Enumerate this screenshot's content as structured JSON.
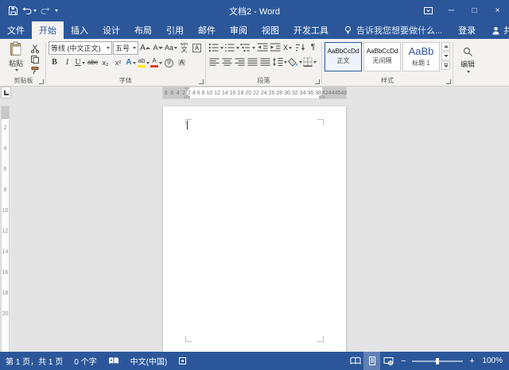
{
  "titlebar": {
    "title": "文档2 - Word",
    "window_controls": {
      "minimize": "─",
      "maximize": "□",
      "close": "×"
    }
  },
  "tabbar": {
    "file_tab": "文件",
    "tabs": [
      "开始",
      "插入",
      "设计",
      "布局",
      "引用",
      "邮件",
      "审阅",
      "视图",
      "开发工具"
    ],
    "tell_me": "告诉我您想要做什么...",
    "sign_in": "登录",
    "share": "共享"
  },
  "ribbon": {
    "clipboard": {
      "label": "剪贴板",
      "paste": "粘贴"
    },
    "font": {
      "label": "字体",
      "name": "等线 (中文正文)",
      "size": "五号",
      "grow": "A",
      "shrink": "A",
      "change_case": "Aa",
      "phonetic_ruby": "wén",
      "phonetic_base": "文",
      "char_border": "A",
      "bold": "B",
      "italic": "I",
      "underline": "U",
      "strikethrough": "abc",
      "subscript": "x₂",
      "superscript": "x²",
      "text_effects": "A",
      "highlight": "ab",
      "font_color": "A",
      "enclose": "字",
      "char_shading": "A"
    },
    "paragraph": {
      "label": "段落",
      "asian_layout": "X",
      "pilcrow": "¶"
    },
    "styles": {
      "label": "样式",
      "items": [
        {
          "preview": "AaBbCcDd",
          "name": "正文"
        },
        {
          "preview": "AaBbCcDd",
          "name": "无间隔"
        },
        {
          "preview": "AaBb",
          "name": "标题 1"
        }
      ]
    },
    "editing": {
      "label": "编辑"
    }
  },
  "ruler": {
    "left_margin": [
      "8",
      "6",
      "4",
      "2"
    ],
    "text_area": [
      "2",
      "4",
      "6",
      "8",
      "10",
      "12",
      "14",
      "16",
      "18",
      "20",
      "22",
      "24",
      "26",
      "28",
      "30",
      "32",
      "34",
      "36",
      "38"
    ],
    "right_margin": [
      "42",
      "44",
      "46",
      "48"
    ],
    "vertical": [
      "2",
      "4",
      "6",
      "8",
      "10",
      "12",
      "14",
      "16",
      "18",
      "20"
    ]
  },
  "statusbar": {
    "page_info": "第 1 页，共 1 页",
    "word_count": "0 个字",
    "language": "中文(中国)",
    "zoom_out": "−",
    "zoom_in": "+",
    "zoom_level": "100%"
  },
  "colors": {
    "accent": "#2b579a",
    "ribbon_background": "#f3f2f1",
    "document_background": "#e4e4e4",
    "page_background": "#ffffff",
    "heading_style_blue": "#2f5496",
    "highlight_yellow": "#ffe400",
    "font_color_red": "#e03e2d"
  },
  "icons": {
    "quick_access": [
      "save-icon",
      "undo-icon",
      "redo-icon"
    ],
    "clipboard": [
      "paste-clipboard-icon",
      "cut-scissors-icon",
      "copy-icon",
      "format-painter-icon"
    ],
    "tell_me": "lightbulb-icon",
    "share": "person-icon",
    "editing": "search-icon",
    "statusbar": [
      "proofing-book-icon",
      "macro-record-icon",
      "read-mode-icon",
      "print-layout-icon",
      "web-layout-icon"
    ]
  }
}
